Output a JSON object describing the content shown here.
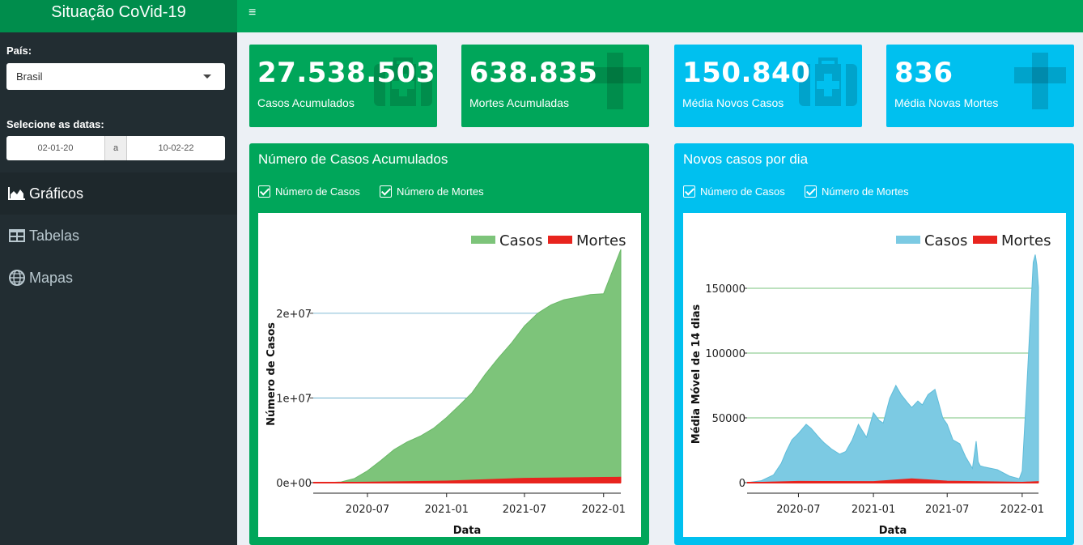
{
  "header": {
    "title": "Situação CoVid-19",
    "menu_icon": "hamburger-icon"
  },
  "sidebar": {
    "country_label": "País:",
    "country_value": "Brasil",
    "dates_label": "Selecione as datas:",
    "date_start": "02-01-20",
    "date_sep": "a",
    "date_end": "10-02-22",
    "menu": [
      {
        "label": "Gráficos",
        "icon": "area-chart-icon",
        "active": true
      },
      {
        "label": "Tabelas",
        "icon": "table-icon",
        "active": false
      },
      {
        "label": "Mapas",
        "icon": "globe-icon",
        "active": false
      }
    ]
  },
  "value_boxes": [
    {
      "value": "27.538.503",
      "label": "Casos Acumulados",
      "icon": "medkit-icon",
      "color": "#00a65a"
    },
    {
      "value": "638.835",
      "label": "Mortes Acumuladas",
      "icon": "cross-icon",
      "color": "#00a65a"
    },
    {
      "value": "150.840",
      "label": "Média Novos Casos",
      "icon": "medkit-icon",
      "color": "#00c0ef"
    },
    {
      "value": "836",
      "label": "Média Novas Mortes",
      "icon": "cross-icon",
      "color": "#00c0ef"
    }
  ],
  "chart_boxes": [
    {
      "title": "Número de Casos Acumulados",
      "check1": "Número de Casos",
      "check2": "Número de Mortes"
    },
    {
      "title": "Novos casos por dia",
      "check1": "Número de Casos",
      "check2": "Número de Mortes"
    }
  ],
  "colors": {
    "green": "#00a65a",
    "dark_green": "#008d4c",
    "aqua": "#00c0ef",
    "sidebar": "#222d32",
    "casos_area_1": "#7dc47a",
    "casos_area_2": "#7ccae3",
    "mortes": "#e8241e"
  },
  "chart_data": [
    {
      "type": "area",
      "xlabel": "Data",
      "ylabel": "Número de Casos",
      "xticks": [
        "2020-07",
        "2021-01",
        "2021-07",
        "2022-01"
      ],
      "yticks": [
        "0e+00",
        "1e+07",
        "2e+07"
      ],
      "ylim": [
        0,
        27538503
      ],
      "legend": "top-right",
      "series": [
        {
          "name": "Casos",
          "x": [
            "2020-02-26",
            "2020-04-01",
            "2020-05-01",
            "2020-06-01",
            "2020-07-01",
            "2020-08-01",
            "2020-09-01",
            "2020-10-01",
            "2020-11-01",
            "2020-12-01",
            "2021-01-01",
            "2021-02-01",
            "2021-03-01",
            "2021-04-01",
            "2021-05-01",
            "2021-06-01",
            "2021-07-01",
            "2021-08-01",
            "2021-09-01",
            "2021-10-01",
            "2021-11-01",
            "2021-12-01",
            "2022-01-01",
            "2022-02-10"
          ],
          "values": [
            0,
            6800,
            86000,
            500000,
            1400000,
            2600000,
            3900000,
            4800000,
            5500000,
            6400000,
            7700000,
            9200000,
            10600000,
            12800000,
            14700000,
            16500000,
            18500000,
            20000000,
            21000000,
            21600000,
            21900000,
            22200000,
            22300000,
            27538503
          ]
        },
        {
          "name": "Mortes",
          "x": [
            "2020-02-26",
            "2020-07-01",
            "2021-01-01",
            "2021-07-01",
            "2022-01-01",
            "2022-02-10"
          ],
          "values": [
            0,
            60000,
            195000,
            520000,
            620000,
            638835
          ]
        }
      ]
    },
    {
      "type": "area",
      "xlabel": "Data",
      "ylabel": "Média Móvel de 14 dias",
      "xticks": [
        "2020-07",
        "2021-01",
        "2021-07",
        "2022-01"
      ],
      "yticks": [
        "0",
        "50000",
        "100000",
        "150000"
      ],
      "ylim": [
        0,
        180000
      ],
      "legend": "top-right",
      "series": [
        {
          "name": "Casos",
          "x": [
            "2020-02-26",
            "2020-04-01",
            "2020-05-01",
            "2020-05-20",
            "2020-06-01",
            "2020-06-15",
            "2020-07-01",
            "2020-07-20",
            "2020-08-01",
            "2020-08-20",
            "2020-09-01",
            "2020-09-20",
            "2020-10-10",
            "2020-10-25",
            "2020-11-10",
            "2020-11-25",
            "2020-12-15",
            "2021-01-01",
            "2021-01-15",
            "2021-01-25",
            "2021-02-10",
            "2021-02-25",
            "2021-03-10",
            "2021-03-25",
            "2021-04-05",
            "2021-04-20",
            "2021-05-01",
            "2021-05-15",
            "2021-06-01",
            "2021-06-20",
            "2021-07-01",
            "2021-07-15",
            "2021-08-01",
            "2021-08-15",
            "2021-09-01",
            "2021-09-10",
            "2021-09-15",
            "2021-09-20",
            "2021-10-01",
            "2021-11-01",
            "2021-12-01",
            "2021-12-25",
            "2022-01-01",
            "2022-01-10",
            "2022-01-20",
            "2022-01-28",
            "2022-02-02",
            "2022-02-06",
            "2022-02-10"
          ],
          "values": [
            0,
            1500,
            6000,
            15000,
            24000,
            33000,
            38000,
            45000,
            42000,
            35000,
            31000,
            26000,
            22000,
            24000,
            33000,
            45000,
            35000,
            54000,
            48000,
            46000,
            65000,
            75000,
            68000,
            62000,
            58000,
            63000,
            60000,
            68000,
            72000,
            50000,
            45000,
            33000,
            30000,
            20000,
            11000,
            32000,
            16000,
            13000,
            12000,
            10000,
            5000,
            3000,
            9000,
            60000,
            120000,
            170000,
            176000,
            168000,
            150840
          ]
        },
        {
          "name": "Mortes",
          "x": [
            "2020-02-26",
            "2020-07-01",
            "2021-01-01",
            "2021-04-05",
            "2021-07-01",
            "2022-01-01",
            "2022-02-10"
          ],
          "values": [
            0,
            1000,
            900,
            3000,
            1200,
            300,
            836
          ]
        }
      ]
    }
  ]
}
